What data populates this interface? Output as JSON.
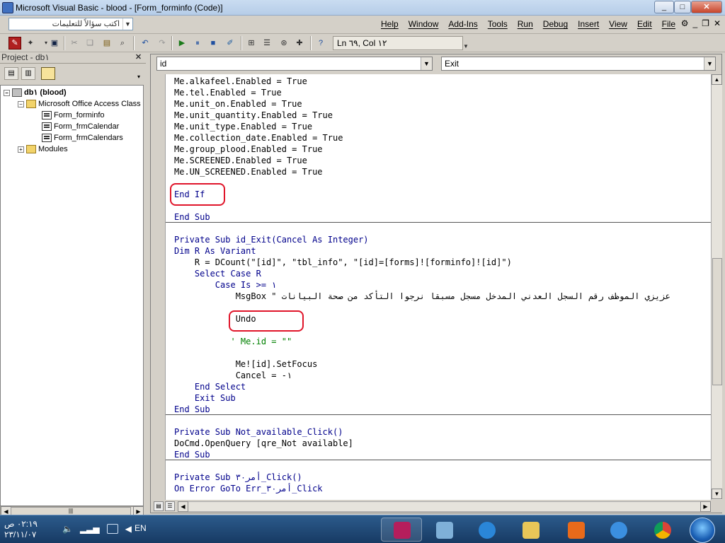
{
  "window": {
    "title": "Microsoft Visual Basic - blood - [Form_forminfo (Code)]",
    "caption_buttons": [
      "_",
      "□",
      "✕"
    ]
  },
  "menubar": {
    "ask_placeholder": "اكتب سؤالاً للتعليمات",
    "menus": [
      "File",
      "Edit",
      "View",
      "Insert",
      "Debug",
      "Run",
      "Tools",
      "Add-Ins",
      "Window",
      "Help"
    ],
    "right_icons": [
      "vb-icon",
      "minimize",
      "restore",
      "close"
    ]
  },
  "toolbar": {
    "position": "Ln ٦٩, Col ١٢"
  },
  "project": {
    "title": "Project - db١",
    "tree": [
      {
        "label": "db١ (blood)",
        "level": 0,
        "type": "project",
        "expander": "-"
      },
      {
        "label": "Microsoft Office Access Class",
        "level": 1,
        "type": "folder",
        "expander": "-"
      },
      {
        "label": "Form_forminfo",
        "level": 2,
        "type": "form"
      },
      {
        "label": "Form_frmCalendar",
        "level": 2,
        "type": "form"
      },
      {
        "label": "Form_frmCalendars",
        "level": 2,
        "type": "form"
      },
      {
        "label": "Modules",
        "level": 1,
        "type": "folder",
        "expander": "+"
      }
    ]
  },
  "code_window": {
    "object_combo": "id",
    "procedure_combo": "Exit",
    "lines": [
      "Me.alkafeel.Enabled = True",
      "Me.tel.Enabled = True",
      "Me.unit_on.Enabled = True",
      "Me.unit_quantity.Enabled = True",
      "Me.unit_type.Enabled = True",
      "Me.collection_date.Enabled = True",
      "Me.group_plood.Enabled = True",
      "Me.SCREENED.Enabled = True",
      "Me.UN_SCREENED.Enabled = True",
      "",
      "End If",
      "",
      "End Sub",
      "",
      "Private Sub id_Exit(Cancel As Integer)",
      "Dim R As Variant",
      "    R = DCount(\"[id]\", \"tbl_info\", \"[id]=[forms]![forminfo]![id]\")",
      "    Select Case R",
      "        Case Is >= ١",
      "            MsgBox \" عزيزي الموظف رقم السجل العدني المدخل مسجل مسبقا نرجوا التأكد من صحة البيانات",
      "",
      "            Undo",
      "",
      "           ' Me.id = \"\"",
      "",
      "            Me![id].SetFocus",
      "            Cancel = -١",
      "    End Select",
      "    Exit Sub",
      "End Sub",
      "",
      "Private Sub Not_available_Click()",
      "DoCmd.OpenQuery [qre_Not available]",
      "End Sub",
      "",
      "Private Sub أمر٣٠_Click()",
      "On Error GoTo Err_أمر٣٠_Click"
    ]
  },
  "taskbar": {
    "time": "٠٢:١٩ ص",
    "date": "٢٣/١١/٠٧",
    "language": "EN",
    "apps": [
      "access-icon",
      "notepad-icon",
      "explorer-ie-icon",
      "folder-icon",
      "media-icon",
      "ie-icon",
      "chrome-icon"
    ]
  }
}
